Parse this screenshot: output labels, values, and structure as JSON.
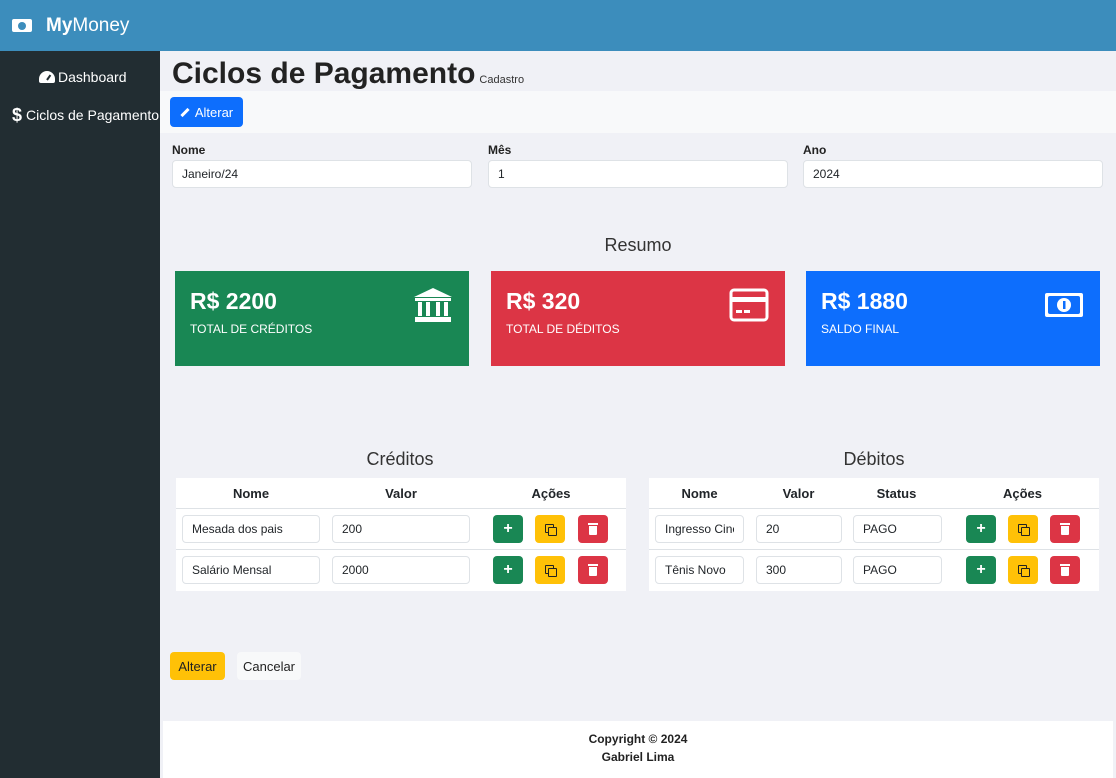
{
  "app": {
    "brand_bold": "My",
    "brand_rest": "Money"
  },
  "sidebar": {
    "items": [
      {
        "label": "Dashboard"
      },
      {
        "label": "Ciclos de Pagamento"
      }
    ]
  },
  "page": {
    "title": "Ciclos de Pagamento",
    "subtitle": "Cadastro"
  },
  "toolbar": {
    "alterar_label": "Alterar"
  },
  "form": {
    "nome": {
      "label": "Nome",
      "value": "Janeiro/24"
    },
    "mes": {
      "label": "Mês",
      "value": "1"
    },
    "ano": {
      "label": "Ano",
      "value": "2024"
    }
  },
  "resumo": {
    "title": "Resumo",
    "boxes": [
      {
        "value": "R$ 2200",
        "label": "TOTAL DE CRÉDITOS",
        "icon": "bank-icon",
        "color": "#198754"
      },
      {
        "value": "R$ 320",
        "label": "TOTAL DE DÉDITOS",
        "icon": "credit-card-icon",
        "color": "#dc3545"
      },
      {
        "value": "R$ 1880",
        "label": "SALDO FINAL",
        "icon": "money-icon",
        "color": "#0d6efd"
      }
    ]
  },
  "creditos": {
    "title": "Créditos",
    "headers": [
      "Nome",
      "Valor",
      "Ações"
    ],
    "rows": [
      {
        "nome": "Mesada dos pais",
        "valor": "200"
      },
      {
        "nome": "Salário Mensal",
        "valor": "2000"
      }
    ]
  },
  "debitos": {
    "title": "Débitos",
    "headers": [
      "Nome",
      "Valor",
      "Status",
      "Ações"
    ],
    "rows": [
      {
        "nome": "Ingresso Cinema",
        "valor": "20",
        "status": "PAGO"
      },
      {
        "nome": "Tênis Novo",
        "valor": "300",
        "status": "PAGO"
      }
    ]
  },
  "actions": {
    "submit_label": "Alterar",
    "cancel_label": "Cancelar"
  },
  "footer": {
    "line1": "Copyright © 2024",
    "line2": "Gabriel Lima"
  },
  "colors": {
    "header": "#3c8dbc",
    "sidebar": "#222d32",
    "success": "#198754",
    "danger": "#dc3545",
    "primary": "#0d6efd",
    "warning": "#ffc107"
  }
}
